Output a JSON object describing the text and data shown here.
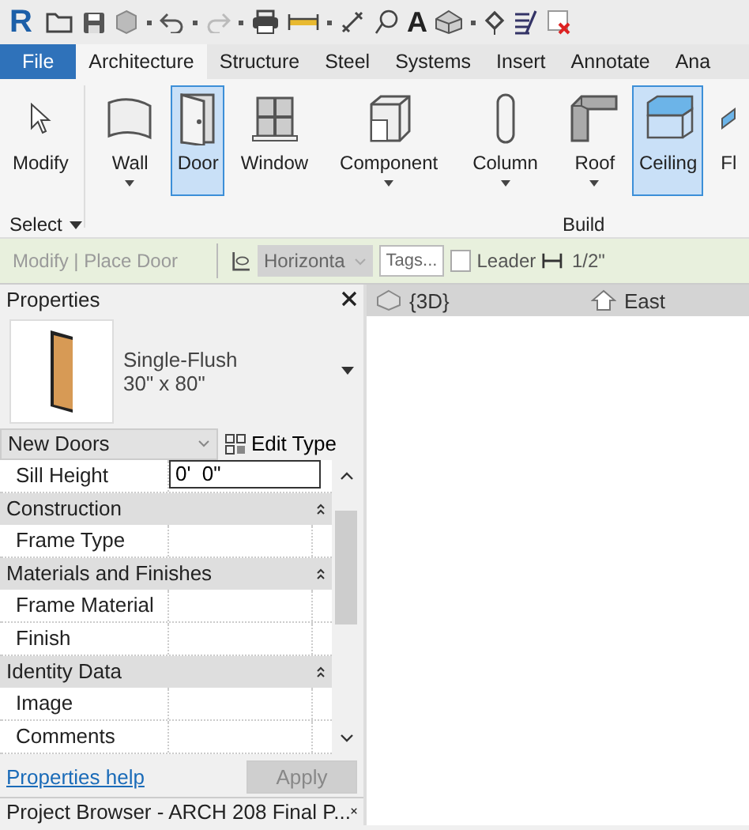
{
  "quick_access": {
    "logo": "R",
    "text_tool": "A"
  },
  "tabs": [
    {
      "label": "File",
      "kind": "file",
      "selected": false
    },
    {
      "label": "Architecture",
      "kind": "tab",
      "selected": true
    },
    {
      "label": "Structure",
      "kind": "tab",
      "selected": false
    },
    {
      "label": "Steel",
      "kind": "tab",
      "selected": false
    },
    {
      "label": "Systems",
      "kind": "tab",
      "selected": false
    },
    {
      "label": "Insert",
      "kind": "tab",
      "selected": false
    },
    {
      "label": "Annotate",
      "kind": "tab",
      "selected": false
    },
    {
      "label": "Ana",
      "kind": "tab",
      "selected": false
    }
  ],
  "ribbon": {
    "tools": [
      {
        "label": "Modify",
        "kind": "modify",
        "selected": false,
        "dropdown": false
      },
      {
        "label": "Wall",
        "kind": "wall",
        "selected": false,
        "dropdown": true
      },
      {
        "label": "Door",
        "kind": "door",
        "selected": true,
        "dropdown": false
      },
      {
        "label": "Window",
        "kind": "window",
        "selected": false,
        "dropdown": false
      },
      {
        "label": "Component",
        "kind": "component",
        "selected": false,
        "dropdown": true
      },
      {
        "label": "Column",
        "kind": "column",
        "selected": false,
        "dropdown": true
      },
      {
        "label": "Roof",
        "kind": "roof",
        "selected": false,
        "dropdown": true
      },
      {
        "label": "Ceiling",
        "kind": "ceiling",
        "selected": true,
        "dropdown": false
      },
      {
        "label": "Fl",
        "kind": "floor",
        "selected": false,
        "dropdown": false
      }
    ],
    "panels": [
      {
        "label": "Select",
        "dropdown": true
      },
      {
        "label": "Build",
        "dropdown": false
      }
    ]
  },
  "options_bar": {
    "context": "Modify | Place Door",
    "orientation": "Horizonta",
    "tags_button": "Tags...",
    "leader": {
      "label": "Leader",
      "checked": false
    },
    "length": "1/2\""
  },
  "properties": {
    "title": "Properties",
    "type_name": "Single-Flush",
    "type_size": "30\" x 80\"",
    "filter": "New Doors",
    "edit_type": "Edit Type",
    "rows": [
      {
        "kind": "param",
        "name": "Sill Height",
        "value": "0'  0\"",
        "editing": true
      },
      {
        "kind": "group",
        "name": "Construction"
      },
      {
        "kind": "param",
        "name": "Frame Type",
        "editing": false
      },
      {
        "kind": "group",
        "name": "Materials and Finishes"
      },
      {
        "kind": "param",
        "name": "Frame Material",
        "editing": false
      },
      {
        "kind": "param",
        "name": "Finish",
        "editing": false
      },
      {
        "kind": "group",
        "name": "Identity Data"
      },
      {
        "kind": "param",
        "name": "Image",
        "editing": false
      },
      {
        "kind": "param",
        "name": "Comments",
        "editing": false
      }
    ],
    "help_link": "Properties help",
    "apply": {
      "label": "Apply",
      "disabled": true
    }
  },
  "project_browser": {
    "title": "Project Browser - ARCH 208 Final P..."
  },
  "views": [
    {
      "label": "{3D}",
      "kind": "model"
    },
    {
      "label": "East",
      "kind": "elevation"
    }
  ]
}
